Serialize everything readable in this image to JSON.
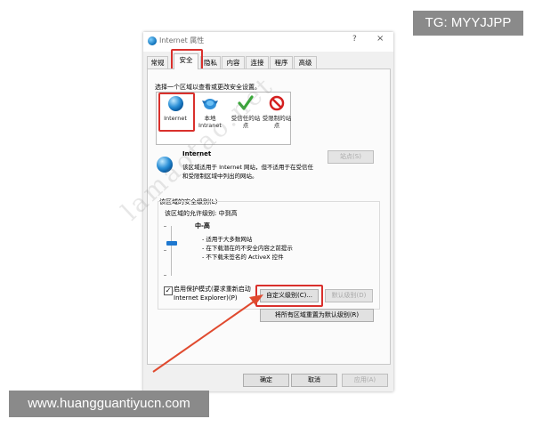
{
  "overlay": {
    "tg_label": "TG: MYYJJPP",
    "site_label": "www.huangguantiyucn.com",
    "watermark_text": "lamaotao.net"
  },
  "window": {
    "title": "Internet 属性",
    "help_symbol": "?",
    "close_symbol": "×"
  },
  "tabs": [
    {
      "label": "常规"
    },
    {
      "label": "安全"
    },
    {
      "label": "隐私"
    },
    {
      "label": "内容"
    },
    {
      "label": "连接"
    },
    {
      "label": "程序"
    },
    {
      "label": "高级"
    }
  ],
  "active_tab": "安全",
  "security": {
    "instruction": "选择一个区域以查看或更改安全设置。",
    "zones": [
      {
        "label": "Internet",
        "icon": "globe-icon"
      },
      {
        "label": "本地 Intranet",
        "icon": "intranet-icon"
      },
      {
        "label": "受信任的站点",
        "icon": "check-icon"
      },
      {
        "label": "受限制的站点",
        "icon": "restricted-icon"
      }
    ],
    "selected_zone": {
      "title": "Internet",
      "desc_line1": "该区域适用于 Internet 网站，但不适用于在受信任",
      "desc_line2": "和受限制区域中列出的网站。"
    },
    "sites_button": "站点(S)",
    "level_group_title": "该区域的安全级别(L)",
    "allowed_levels": "该区域的允许级别: 中到高",
    "level_name": "中-高",
    "level_bullets": [
      "- 适用于大多数网站",
      "- 在下载潜在的不安全内容之前提示",
      "- 不下载未签名的 ActiveX 控件"
    ],
    "slider_level": 0.67,
    "protected_mode_line1": "启用保护模式(要求重新启动",
    "protected_mode_line2": "Internet Explorer)(P)",
    "protected_mode_checked": true,
    "custom_level_button": "自定义级别(C)...",
    "default_level_button": "默认级别(D)",
    "reset_all_button": "将所有区域重置为默认级别(R)"
  },
  "footer": {
    "ok": "确定",
    "cancel": "取消",
    "apply": "应用(A)"
  },
  "colors": {
    "highlight": "#d9302c",
    "arrow": "#e04a2f",
    "overlay_bg": "#8a8a8a"
  }
}
